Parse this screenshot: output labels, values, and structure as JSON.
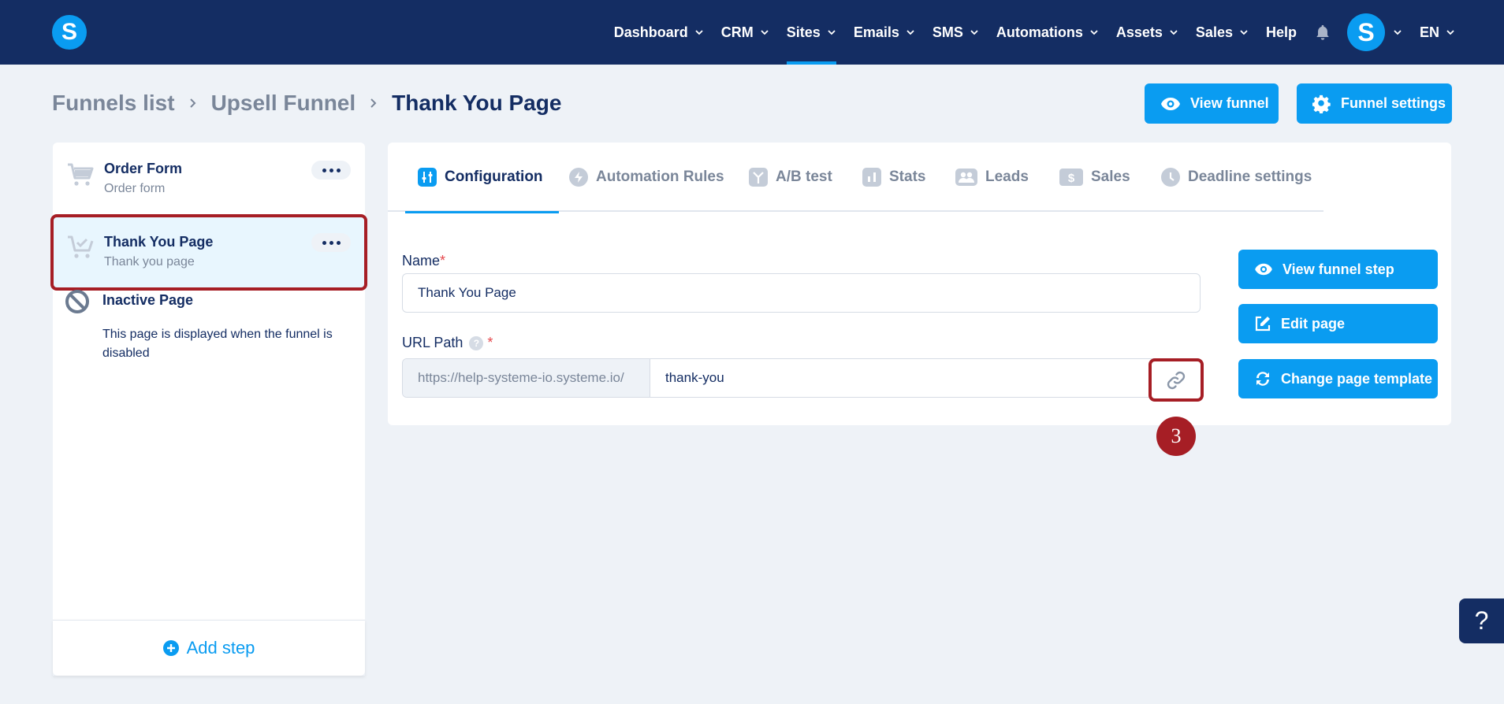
{
  "app": {
    "logo_letter": "S"
  },
  "nav": {
    "items": [
      {
        "label": "Dashboard",
        "has_menu": true
      },
      {
        "label": "CRM",
        "has_menu": true
      },
      {
        "label": "Sites",
        "has_menu": true,
        "active": true
      },
      {
        "label": "Emails",
        "has_menu": true
      },
      {
        "label": "SMS",
        "has_menu": true
      },
      {
        "label": "Automations",
        "has_menu": true
      },
      {
        "label": "Assets",
        "has_menu": true
      },
      {
        "label": "Sales",
        "has_menu": true
      },
      {
        "label": "Help",
        "has_menu": false
      }
    ],
    "avatar_letter": "S",
    "language": "EN"
  },
  "breadcrumb": {
    "items": [
      "Funnels list",
      "Upsell Funnel"
    ],
    "current": "Thank You Page"
  },
  "header_actions": {
    "view_funnel": "View funnel",
    "funnel_settings": "Funnel settings"
  },
  "steps": [
    {
      "title": "Order Form",
      "subtitle": "Order form",
      "icon": "cart-icon"
    },
    {
      "title": "Thank You Page",
      "subtitle": "Thank you page",
      "icon": "cart-check-icon",
      "selected": true
    },
    {
      "title": "Inactive Page",
      "subtitle": "This page is displayed when the funnel is disabled",
      "icon": "ban-icon"
    }
  ],
  "add_step_label": "Add step",
  "tabs": [
    {
      "label": "Configuration",
      "icon": "sliders-icon",
      "active": true
    },
    {
      "label": "Automation Rules",
      "icon": "bolt-icon"
    },
    {
      "label": "A/B test",
      "icon": "split-icon"
    },
    {
      "label": "Stats",
      "icon": "bar-chart-icon"
    },
    {
      "label": "Leads",
      "icon": "users-icon"
    },
    {
      "label": "Sales",
      "icon": "dollar-icon"
    },
    {
      "label": "Deadline settings",
      "icon": "clock-icon"
    }
  ],
  "form": {
    "name_label": "Name",
    "name_value": "Thank You Page",
    "url_label": "URL Path",
    "url_prefix": "https://help-systeme-io.systeme.io/",
    "url_value": "thank-you",
    "required_mark": "*",
    "help_mark": "?"
  },
  "side_actions": {
    "view_step": "View funnel step",
    "edit_page": "Edit page",
    "change_template": "Change page template"
  },
  "annotation_marker": "3",
  "help_fab": "?",
  "colors": {
    "navy": "#142D63",
    "accent": "#0A9CF1",
    "highlight": "#A61E25",
    "background": "#EEF2F7"
  }
}
